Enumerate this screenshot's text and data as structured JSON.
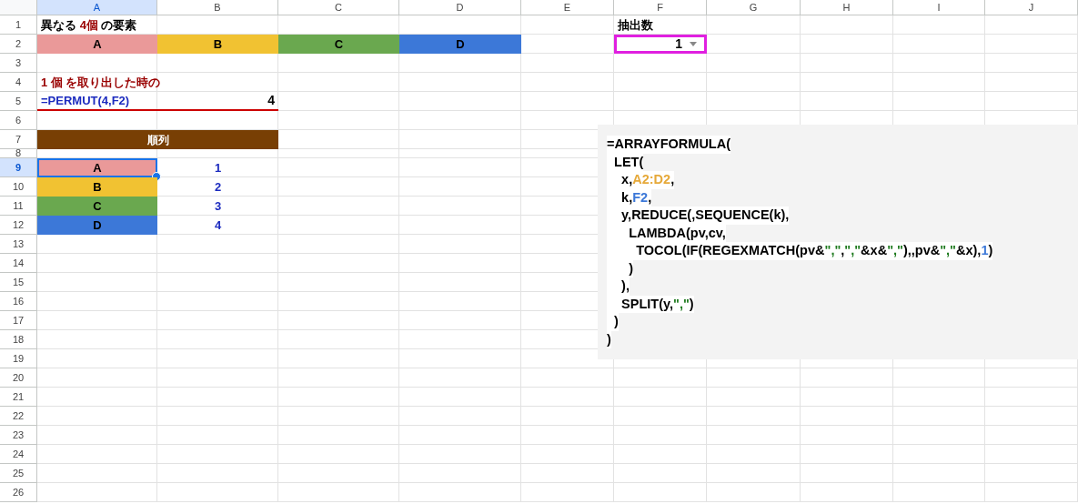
{
  "columns": [
    {
      "label": "A",
      "selected": true
    },
    {
      "label": "B",
      "selected": false
    },
    {
      "label": "C",
      "selected": false
    },
    {
      "label": "D",
      "selected": false
    },
    {
      "label": "E",
      "selected": false
    },
    {
      "label": "F",
      "selected": false
    },
    {
      "label": "G",
      "selected": false
    },
    {
      "label": "H",
      "selected": false
    },
    {
      "label": "I",
      "selected": false
    },
    {
      "label": "J",
      "selected": false
    }
  ],
  "rows": [
    {
      "label": "1",
      "selected": false
    },
    {
      "label": "2",
      "selected": false
    },
    {
      "label": "3",
      "selected": false
    },
    {
      "label": "4",
      "selected": false
    },
    {
      "label": "5",
      "selected": false
    },
    {
      "label": "6",
      "selected": false
    },
    {
      "label": "7",
      "selected": false
    },
    {
      "label": "8",
      "selected": false
    },
    {
      "label": "9",
      "selected": true
    },
    {
      "label": "10",
      "selected": false
    },
    {
      "label": "11",
      "selected": false
    },
    {
      "label": "12",
      "selected": false
    },
    {
      "label": "13",
      "selected": false
    },
    {
      "label": "14",
      "selected": false
    },
    {
      "label": "15",
      "selected": false
    },
    {
      "label": "16",
      "selected": false
    },
    {
      "label": "17",
      "selected": false
    },
    {
      "label": "18",
      "selected": false
    },
    {
      "label": "19",
      "selected": false
    },
    {
      "label": "20",
      "selected": false
    },
    {
      "label": "21",
      "selected": false
    },
    {
      "label": "22",
      "selected": false
    },
    {
      "label": "23",
      "selected": false
    },
    {
      "label": "24",
      "selected": false
    },
    {
      "label": "25",
      "selected": false
    },
    {
      "label": "26",
      "selected": false
    }
  ],
  "title": [
    {
      "text": "異なる ",
      "kind": "plain"
    },
    {
      "text": "4個",
      "kind": "accent"
    },
    {
      "text": " の要素",
      "kind": "plain"
    }
  ],
  "elements": [
    {
      "label": "A",
      "color": "#ea9999"
    },
    {
      "label": "B",
      "color": "#f1c232"
    },
    {
      "label": "C",
      "color": "#6aa84f"
    },
    {
      "label": "D",
      "color": "#3c78d8"
    }
  ],
  "count_label": "抽出数",
  "count_dropdown": {
    "value": "1"
  },
  "subtitle": "1 個 を取り出した時の",
  "permut": {
    "formula": "=PERMUT(4,F2)",
    "result": "4"
  },
  "table_header": "順列",
  "results": [
    {
      "label": "A",
      "color": "#ea9999",
      "number": "1",
      "selected": true
    },
    {
      "label": "B",
      "color": "#f1c232",
      "number": "2",
      "selected": false
    },
    {
      "label": "C",
      "color": "#6aa84f",
      "number": "3",
      "selected": false
    },
    {
      "label": "D",
      "color": "#3c78d8",
      "number": "4",
      "selected": false
    }
  ],
  "formula_box": [
    [
      {
        "text": "=ARRAYFORMULA(",
        "kind": "plain"
      }
    ],
    [
      {
        "text": "  LET(",
        "kind": "plain"
      }
    ],
    [
      {
        "text": "    x,",
        "kind": "plain"
      },
      {
        "text": "A2:D2",
        "kind": "range_orange"
      },
      {
        "text": ",",
        "kind": "plain"
      }
    ],
    [
      {
        "text": "    k,",
        "kind": "plain"
      },
      {
        "text": "F2",
        "kind": "range_blue"
      },
      {
        "text": ",",
        "kind": "plain"
      }
    ],
    [
      {
        "text": "    y,REDUCE(,SEQUENCE(k),",
        "kind": "plain"
      }
    ],
    [
      {
        "text": "      LAMBDA(pv,cv,",
        "kind": "plain"
      }
    ],
    [
      {
        "text": "        TOCOL(IF(REGEXMATCH(pv&",
        "kind": "plain"
      },
      {
        "text": "\",\"",
        "kind": "string"
      },
      {
        "text": ",",
        "kind": "plain"
      },
      {
        "text": "\",\"",
        "kind": "string"
      },
      {
        "text": "&x&",
        "kind": "plain"
      },
      {
        "text": "\",\"",
        "kind": "string"
      },
      {
        "text": "),,pv&",
        "kind": "plain"
      },
      {
        "text": "\",\"",
        "kind": "string"
      },
      {
        "text": "&x),",
        "kind": "plain"
      },
      {
        "text": "1",
        "kind": "number"
      },
      {
        "text": ")",
        "kind": "plain"
      }
    ],
    [
      {
        "text": "      )",
        "kind": "plain"
      }
    ],
    [
      {
        "text": "    ),",
        "kind": "plain"
      }
    ],
    [
      {
        "text": "    SPLIT(y,",
        "kind": "plain"
      },
      {
        "text": "\",\"",
        "kind": "string"
      },
      {
        "text": ")",
        "kind": "plain"
      }
    ],
    [
      {
        "text": "  )",
        "kind": "plain"
      }
    ],
    [
      {
        "text": ")",
        "kind": "plain"
      }
    ]
  ]
}
